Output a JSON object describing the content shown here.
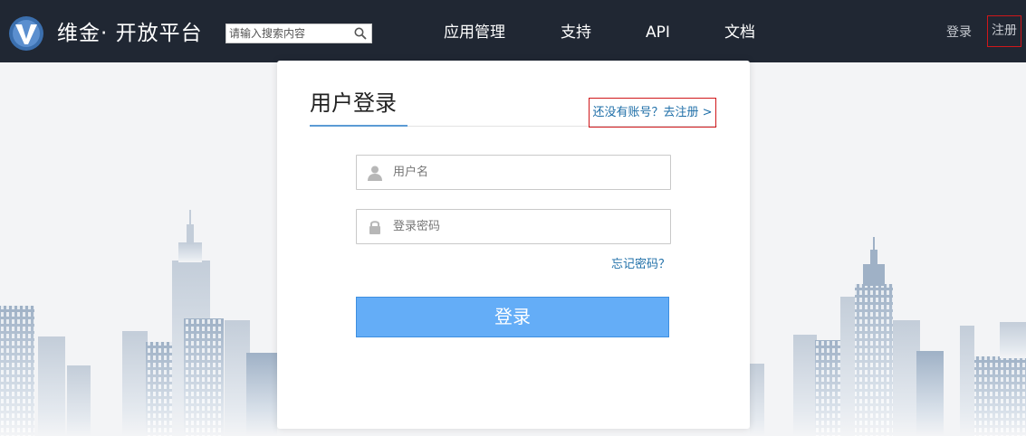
{
  "header": {
    "brand": "维金· 开放平台",
    "search_placeholder": "请输入搜索内容",
    "nav": [
      "应用管理",
      "支持",
      "API",
      "文档"
    ],
    "login": "登录",
    "register": "注册"
  },
  "login_card": {
    "title": "用户登录",
    "register_prompt": "还没有账号？去注册 >",
    "username_placeholder": "用户名",
    "password_placeholder": "登录密码",
    "forgot_password": "忘记密码？",
    "submit": "登录"
  },
  "icons": [
    "logo-v-icon",
    "search-icon",
    "user-icon",
    "lock-icon"
  ],
  "colors": {
    "header_bg": "#202733",
    "primary_button": "#64adf7",
    "link": "#1f6fa8",
    "highlight_border": "#d0171a"
  }
}
